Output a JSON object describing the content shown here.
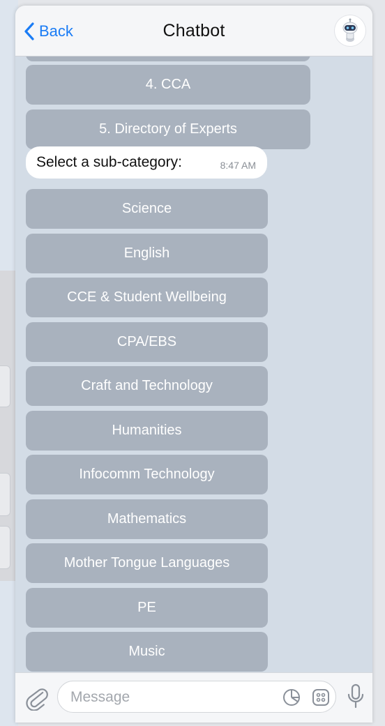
{
  "header": {
    "back_label": "Back",
    "title": "Chatbot"
  },
  "keyboard_top": [
    {
      "label": "4. CCA"
    },
    {
      "label": "5. Directory of Experts"
    }
  ],
  "message": {
    "text": "Select a sub-category:",
    "time": "8:47 AM"
  },
  "subcategories": [
    {
      "label": "Science"
    },
    {
      "label": "English"
    },
    {
      "label": "CCE & Student Wellbeing"
    },
    {
      "label": "CPA/EBS"
    },
    {
      "label": "Craft and Technology"
    },
    {
      "label": "Humanities"
    },
    {
      "label": "Infocomm Technology"
    },
    {
      "label": "Mathematics"
    },
    {
      "label": "Mother Tongue Languages"
    },
    {
      "label": "PE"
    },
    {
      "label": "Music"
    }
  ],
  "input": {
    "placeholder": "Message",
    "value": ""
  },
  "icons": {
    "back": "chevron-left-icon",
    "avatar": "robot-avatar-icon",
    "attach": "paperclip-icon",
    "sticker": "sticker-icon",
    "commands": "bot-commands-icon",
    "mic": "microphone-icon"
  },
  "colors": {
    "accent": "#1a7cf5",
    "chat_background": "#d3dce6",
    "keyboard_button": "#a9b2be"
  }
}
